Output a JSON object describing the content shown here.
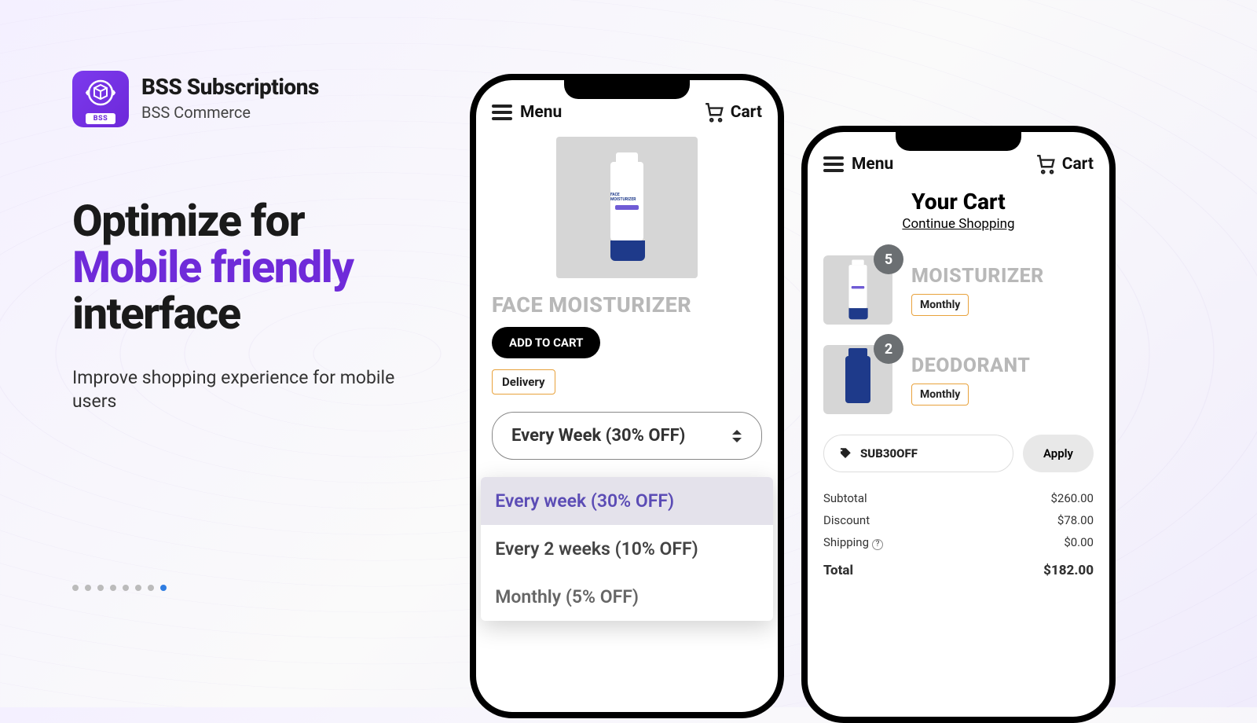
{
  "brand": {
    "title": "BSS Subscriptions",
    "subtitle": "BSS Commerce",
    "badge": "BSS"
  },
  "headline": {
    "line1": "Optimize for",
    "line2": "Mobile friendly",
    "line3": "interface"
  },
  "subhead": "Improve shopping experience for mobile users",
  "carousel": {
    "total": 8,
    "active": 7
  },
  "phone1": {
    "menu": "Menu",
    "cart": "Cart",
    "product_title": "FACE MOISTURIZER",
    "add_to_cart": "ADD TO CART",
    "delivery_badge": "Delivery",
    "dropdown_selected": "Every Week (30% OFF)",
    "options": [
      {
        "label": "Every week (30% OFF)",
        "selected": true
      },
      {
        "label": "Every 2 weeks (10% OFF)",
        "selected": false
      },
      {
        "label": "Monthly (5% OFF)",
        "selected": false
      }
    ]
  },
  "phone2": {
    "menu": "Menu",
    "cart": "Cart",
    "cart_title": "Your Cart",
    "continue": "Continue Shopping",
    "items": [
      {
        "name": "MOISTURIZER",
        "qty": "5",
        "freq": "Monthly"
      },
      {
        "name": "DEODORANT",
        "qty": "2",
        "freq": "Monthly"
      }
    ],
    "promo": {
      "code": "SUB30OFF",
      "apply": "Apply"
    },
    "totals": {
      "subtotal_label": "Subtotal",
      "subtotal": "$260.00",
      "discount_label": "Discount",
      "discount": "$78.00",
      "shipping_label": "Shipping",
      "shipping": "$0.00",
      "total_label": "Total",
      "total": "$182.00"
    }
  }
}
